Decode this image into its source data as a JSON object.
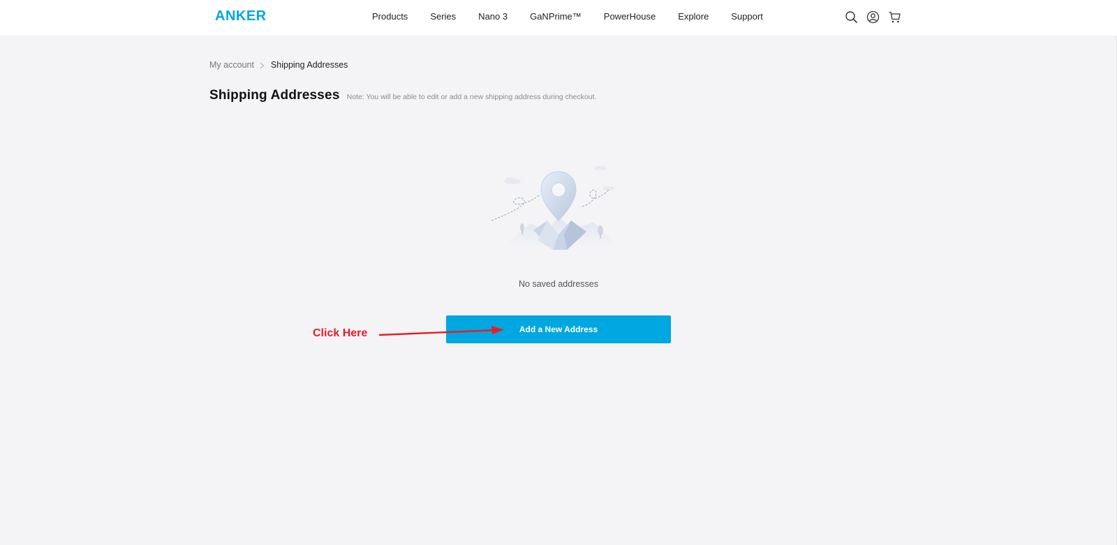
{
  "header": {
    "logo_text": "ANKER",
    "nav": [
      "Products",
      "Series",
      "Nano 3",
      "GaNPrime™",
      "PowerHouse",
      "Explore",
      "Support"
    ],
    "icons": [
      "search-icon",
      "account-icon",
      "cart-icon"
    ]
  },
  "breadcrumb": {
    "parent": "My account",
    "current": "Shipping Addresses"
  },
  "page": {
    "title": "Shipping Addresses",
    "note": "Note: You will be able to edit or add a new shipping address during checkout."
  },
  "empty_state": {
    "message": "No saved addresses",
    "illustration": "location-pin-icon"
  },
  "actions": {
    "add_address_label": "Add a New Address"
  },
  "annotation": {
    "label": "Click Here"
  },
  "colors": {
    "accent": "#00a7e1",
    "annotation": "#e81c24",
    "background": "#f4f4f6"
  }
}
